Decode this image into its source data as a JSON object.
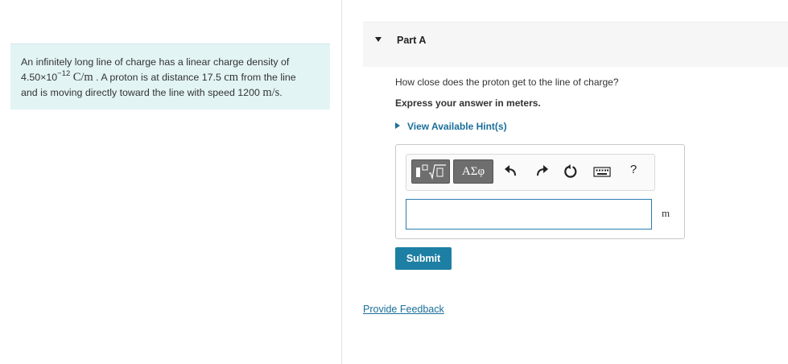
{
  "problem": {
    "text_1": "An infinitely long line of charge has a linear charge density of",
    "density_mantissa": "4.50×10",
    "density_exponent": "−12",
    "density_unit": "C/m",
    "text_2": ". A proton is at distance 17.5",
    "distance_unit": "cm",
    "text_3": "from the line",
    "text_4": "and is moving directly toward the line with speed 1200",
    "speed_unit": "m/s",
    "text_5": "."
  },
  "part": {
    "title": "Part A",
    "question": "How close does the proton get to the line of charge?",
    "instruction": "Express your answer in meters.",
    "hints_label": "View Available Hint(s)"
  },
  "toolbar": {
    "greek_label": "ΑΣφ",
    "help_label": "?",
    "icons": [
      "templates-icon",
      "greek-symbols-icon",
      "undo-icon",
      "redo-icon",
      "reset-icon",
      "keyboard-icon",
      "help-icon"
    ]
  },
  "answer": {
    "value": "",
    "unit": "m"
  },
  "actions": {
    "submit_label": "Submit",
    "feedback_label": "Provide Feedback"
  },
  "colors": {
    "problem_bg": "#e3f4f5",
    "link": "#1a6f99",
    "submit_bg": "#1d7fa3",
    "input_border": "#2a7ab0",
    "toolbar_dark_button": "#6e6e6e"
  }
}
